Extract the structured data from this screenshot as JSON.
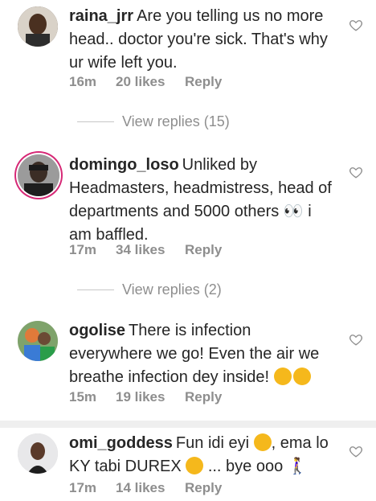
{
  "comments": [
    {
      "username": "raina_jrr",
      "text": "Are you telling us no more head.. doctor you're sick. That's why ur wife left you.",
      "time": "16m",
      "likes": "20 likes",
      "reply": "Reply",
      "view_replies": "View replies (15)"
    },
    {
      "username": "domingo_loso",
      "text": "Unliked by Headmasters, headmistress, head of departments and 5000 others 👀 i am baffled.",
      "time": "17m",
      "likes": "34 likes",
      "reply": "Reply",
      "view_replies": "View replies (2)"
    },
    {
      "username": "ogolise",
      "text": "There is infection everywhere we go! Even the air we breathe infection dey inside!",
      "time": "15m",
      "likes": "19 likes",
      "reply": "Reply"
    },
    {
      "username": "omi_goddess",
      "text_a": "Fun idi eyi",
      "text_b": ", ema lo KY tabi DUREX",
      "text_c": "... bye ooo 🚶‍♀",
      "time": "17m",
      "likes": "14 likes",
      "reply": "Reply"
    }
  ],
  "icons": {
    "like": "heart-outline-icon",
    "emoji_sad": "sad-face-emoji-icon",
    "emoji_flushed": "flushed-face-emoji-icon",
    "emoji_wink": "smirk-face-emoji-icon"
  },
  "colors": {
    "username": "#262626",
    "meta": "#8e8e8e",
    "story_ring": "#d62976",
    "divider": "#efefef"
  }
}
